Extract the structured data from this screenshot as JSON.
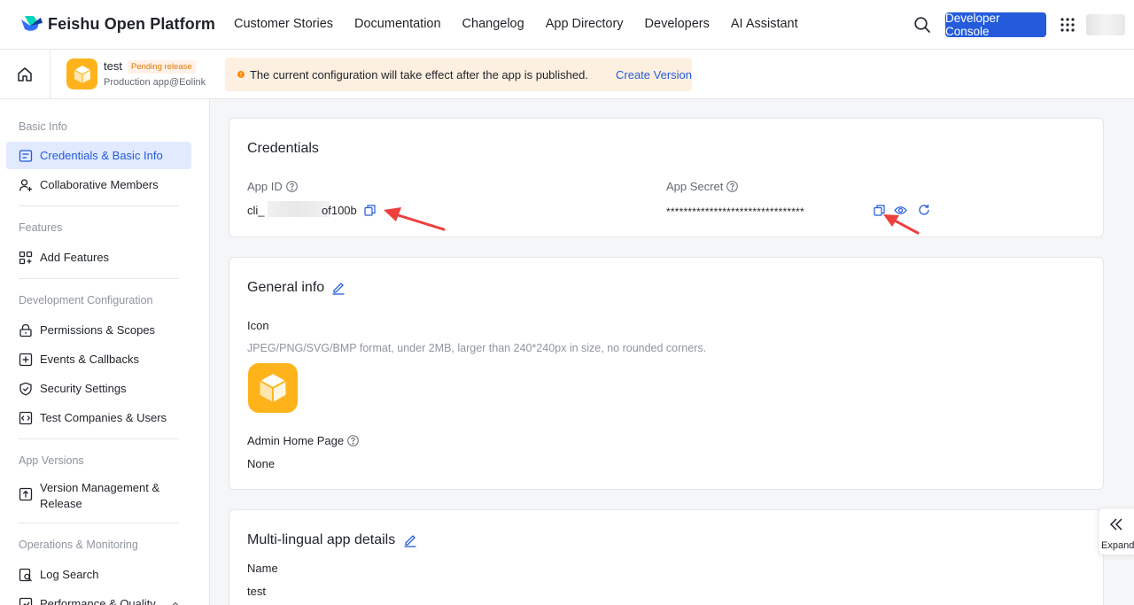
{
  "nav": {
    "brand": "Feishu Open Platform",
    "links": [
      "Customer Stories",
      "Documentation",
      "Changelog",
      "App Directory",
      "Developers",
      "AI Assistant"
    ],
    "console_button": "Developer Console",
    "accent": "#245bdb"
  },
  "app": {
    "name": "test",
    "badge": "Pending release",
    "subtitle": "Production app@Eolink"
  },
  "notice": {
    "text": "The current configuration will take effect after the app is published.",
    "link": "Create Version"
  },
  "sidebar": {
    "groups": [
      {
        "title": "Basic Info",
        "items": [
          "Credentials & Basic Info",
          "Collaborative Members"
        ]
      },
      {
        "title": "Features",
        "items": [
          "Add Features"
        ]
      },
      {
        "title": "Development Configuration",
        "items": [
          "Permissions & Scopes",
          "Events & Callbacks",
          "Security Settings",
          "Test Companies & Users"
        ]
      },
      {
        "title": "App Versions",
        "items": [
          "Version Management & Release"
        ]
      },
      {
        "title": "Operations & Monitoring",
        "items": [
          "Log Search",
          "Performance & Quality"
        ]
      }
    ],
    "active": "Credentials & Basic Info"
  },
  "credentials": {
    "title": "Credentials",
    "app_id_label": "App ID",
    "app_id_prefix": "cli_",
    "app_id_suffix": "of100b",
    "app_secret_label": "App Secret",
    "app_secret_masked": "********************************"
  },
  "general": {
    "title": "General info",
    "icon_label": "Icon",
    "icon_hint": "JPEG/PNG/SVG/BMP format, under 2MB, larger than 240*240px in size, no rounded corners.",
    "admin_label": "Admin Home Page",
    "admin_value": "None"
  },
  "multilingual": {
    "title": "Multi-lingual app details",
    "name_label": "Name",
    "name_value": "test"
  },
  "expand": {
    "label": "Expand"
  }
}
